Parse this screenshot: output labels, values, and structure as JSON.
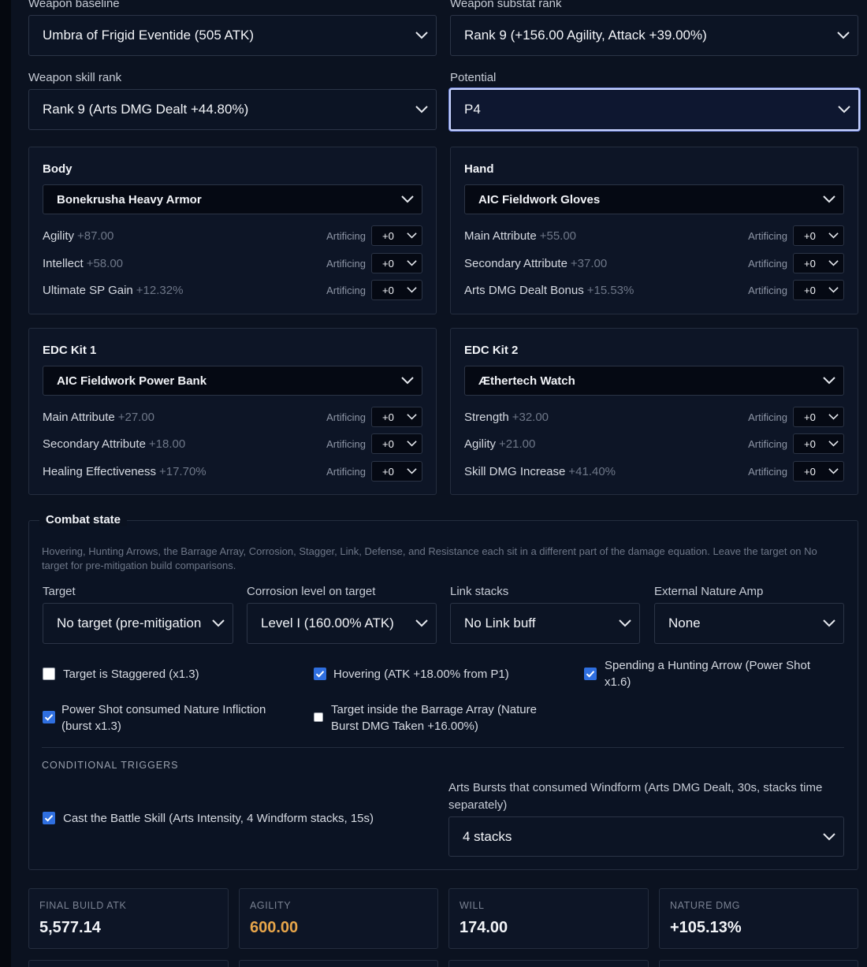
{
  "weapon": {
    "baseline_label": "Weapon baseline",
    "baseline_value": "Umbra of Frigid Eventide (505 ATK)",
    "substat_label": "Weapon substat rank",
    "substat_value": "Rank 9 (+156.00 Agility, Attack +39.00%)",
    "skill_label": "Weapon skill rank",
    "skill_value": "Rank 9 (Arts DMG Dealt +44.80%)",
    "potential_label": "Potential",
    "potential_value": "P4"
  },
  "artificing_label": "Artificing",
  "gear": [
    {
      "title": "Body",
      "item": "Bonekrusha Heavy Armor",
      "stats": [
        {
          "name": "Agility",
          "value": "+87.00",
          "level": "+0"
        },
        {
          "name": "Intellect",
          "value": "+58.00",
          "level": "+0"
        },
        {
          "name": "Ultimate SP Gain",
          "value": "+12.32%",
          "level": "+0"
        }
      ]
    },
    {
      "title": "Hand",
      "item": "AIC Fieldwork Gloves",
      "stats": [
        {
          "name": "Main Attribute",
          "value": "+55.00",
          "level": "+0"
        },
        {
          "name": "Secondary Attribute",
          "value": "+37.00",
          "level": "+0"
        },
        {
          "name": "Arts DMG Dealt Bonus",
          "value": "+15.53%",
          "level": "+0"
        }
      ]
    },
    {
      "title": "EDC Kit 1",
      "item": "AIC Fieldwork Power Bank",
      "stats": [
        {
          "name": "Main Attribute",
          "value": "+27.00",
          "level": "+0"
        },
        {
          "name": "Secondary Attribute",
          "value": "+18.00",
          "level": "+0"
        },
        {
          "name": "Healing Effectiveness",
          "value": "+17.70%",
          "level": "+0"
        }
      ]
    },
    {
      "title": "EDC Kit 2",
      "item": "Æthertech Watch",
      "stats": [
        {
          "name": "Strength",
          "value": "+32.00",
          "level": "+0"
        },
        {
          "name": "Agility",
          "value": "+21.00",
          "level": "+0"
        },
        {
          "name": "Skill DMG Increase",
          "value": "+41.40%",
          "level": "+0"
        }
      ]
    }
  ],
  "combat": {
    "legend": "Combat state",
    "description": "Hovering, Hunting Arrows, the Barrage Array, Corrosion, Stagger, Link, Defense, and Resistance each sit in a different part of the damage equation. Leave the target on No target for pre-mitigation build comparisons.",
    "selects": [
      {
        "label": "Target",
        "value": "No target (pre-mitigation)"
      },
      {
        "label": "Corrosion level on target",
        "value": "Level I (160.00% ATK)"
      },
      {
        "label": "Link stacks",
        "value": "No Link buff"
      },
      {
        "label": "External Nature Amp",
        "value": "None"
      }
    ],
    "checkboxes": [
      {
        "label": "Target is Staggered (x1.3)",
        "checked": false
      },
      {
        "label": "Hovering (ATK +18.00% from P1)",
        "checked": true
      },
      {
        "label": "Spending a Hunting Arrow (Power Shot x1.6)",
        "checked": true
      },
      {
        "label": "Power Shot consumed Nature Infliction (burst x1.3)",
        "checked": true
      },
      {
        "label": "Target inside the Barrage Array (Nature Burst DMG Taken +16.00%)",
        "checked": false
      }
    ],
    "triggers_caption": "CONDITIONAL TRIGGERS",
    "trigger_checkbox": {
      "label": "Cast the Battle Skill (Arts Intensity, 4 Windform stacks, 15s)",
      "checked": true
    },
    "windform_label": "Arts Bursts that consumed Windform (Arts DMG Dealt, 30s, stacks time separately)",
    "windform_value": "4 stacks"
  },
  "metrics": [
    {
      "label": "FINAL BUILD ATK",
      "value": "5,577.14"
    },
    {
      "label": "AGILITY",
      "value": "600.00"
    },
    {
      "label": "WILL",
      "value": "174.00"
    },
    {
      "label": "NATURE DMG",
      "value": "+105.13%"
    }
  ],
  "colors": {
    "background": "#0b1220",
    "accent_checkbox": "#2f6fe0",
    "agility_value": "#e8a64a",
    "focus_ring": "#c7d3ff"
  }
}
